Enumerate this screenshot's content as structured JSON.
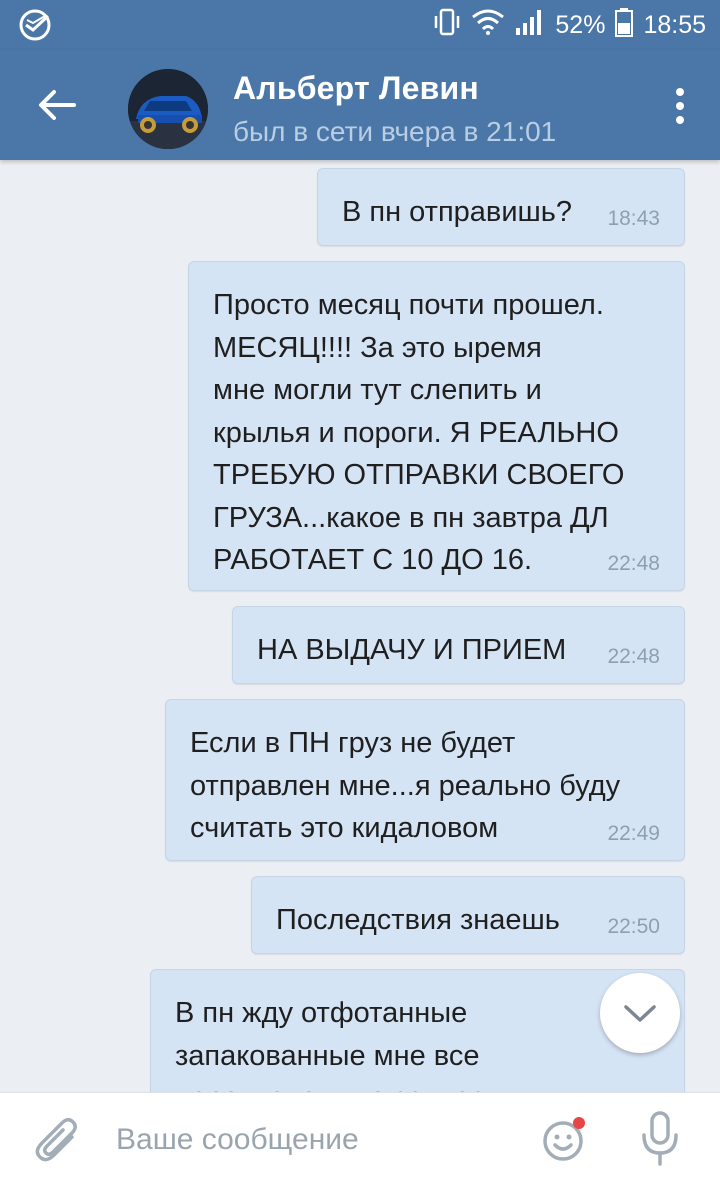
{
  "status_bar": {
    "battery": "52%",
    "time": "18:55",
    "icons": [
      "sberbank-logo-icon",
      "vibrate-icon",
      "wifi-icon",
      "signal-icon",
      "battery-icon"
    ]
  },
  "header": {
    "contact_name": "Альберт Левин",
    "last_seen": "был в сети вчера в 21:01",
    "icons": [
      "back-arrow-icon",
      "more-vert-icon"
    ]
  },
  "messages": [
    {
      "text": "В пн отправишь?",
      "time": "18:43"
    },
    {
      "text": "Просто месяц почти прошел.\nМЕСЯЦ!!!!  За это ыремя\nмне могли тут слепить и\nкрылья и пороги.  Я РЕАЛЬНО\nТРЕБУЮ ОТПРАВКИ СВОЕГО\nГРУЗА...какое в пн завтра ДЛ\nРАБОТАЕТ С 10 ДО 16.",
      "time": "22:48"
    },
    {
      "text": "НА ВЫДАЧУ И ПРИЕМ",
      "time": "22:48"
    },
    {
      "text": "Если в ПН груз не будет\nотправлен мне...я реально буду\nсчитать это кидаловом",
      "time": "22:49"
    },
    {
      "text": "Последствия знаешь",
      "time": "22:50"
    },
    {
      "text": "В пн жду отфотанные\nзапакованные мне все\nперечисленные запчасти",
      "time": ""
    }
  ],
  "composer": {
    "placeholder": "Ваше сообщение",
    "icons": [
      "paperclip-icon",
      "emoji-icon",
      "microphone-icon"
    ],
    "emoji_badge_color": "#e64646"
  },
  "colors": {
    "accent": "#4a76a8",
    "bubble": "#d5e4f5",
    "background": "#ebeef2"
  }
}
